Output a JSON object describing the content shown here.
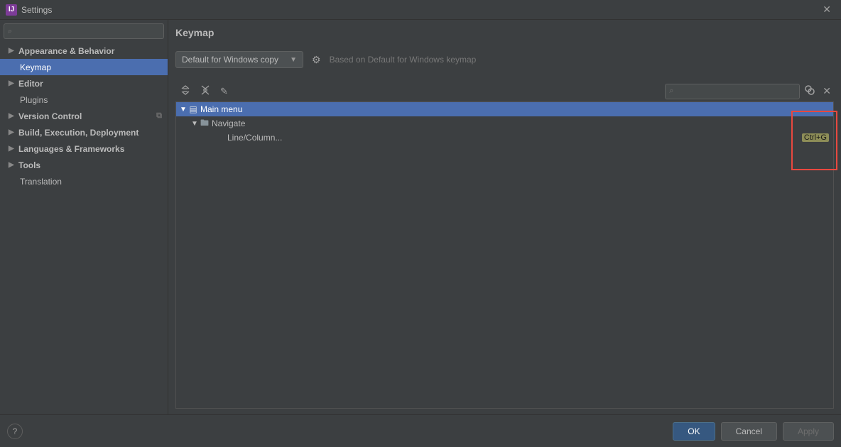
{
  "window": {
    "title": "Settings"
  },
  "sidebar": {
    "items": [
      {
        "label": "Appearance & Behavior",
        "expandable": true,
        "level": 1
      },
      {
        "label": "Keymap",
        "expandable": false,
        "level": 2,
        "selected": true
      },
      {
        "label": "Editor",
        "expandable": true,
        "level": 1
      },
      {
        "label": "Plugins",
        "expandable": false,
        "level": 2
      },
      {
        "label": "Version Control",
        "expandable": true,
        "level": 1,
        "rightIcon": "copy"
      },
      {
        "label": "Build, Execution, Deployment",
        "expandable": true,
        "level": 1
      },
      {
        "label": "Languages & Frameworks",
        "expandable": true,
        "level": 1
      },
      {
        "label": "Tools",
        "expandable": true,
        "level": 1
      },
      {
        "label": "Translation",
        "expandable": false,
        "level": 2
      }
    ]
  },
  "main": {
    "title": "Keymap",
    "scheme": "Default for Windows copy",
    "basedOn": "Based on Default for Windows keymap",
    "tree": {
      "row0": {
        "label": "Main menu"
      },
      "row1": {
        "label": "Navigate"
      },
      "row2": {
        "label": "Line/Column...",
        "shortcut": "Ctrl+G"
      }
    }
  },
  "buttons": {
    "ok": "OK",
    "cancel": "Cancel",
    "apply": "Apply"
  }
}
